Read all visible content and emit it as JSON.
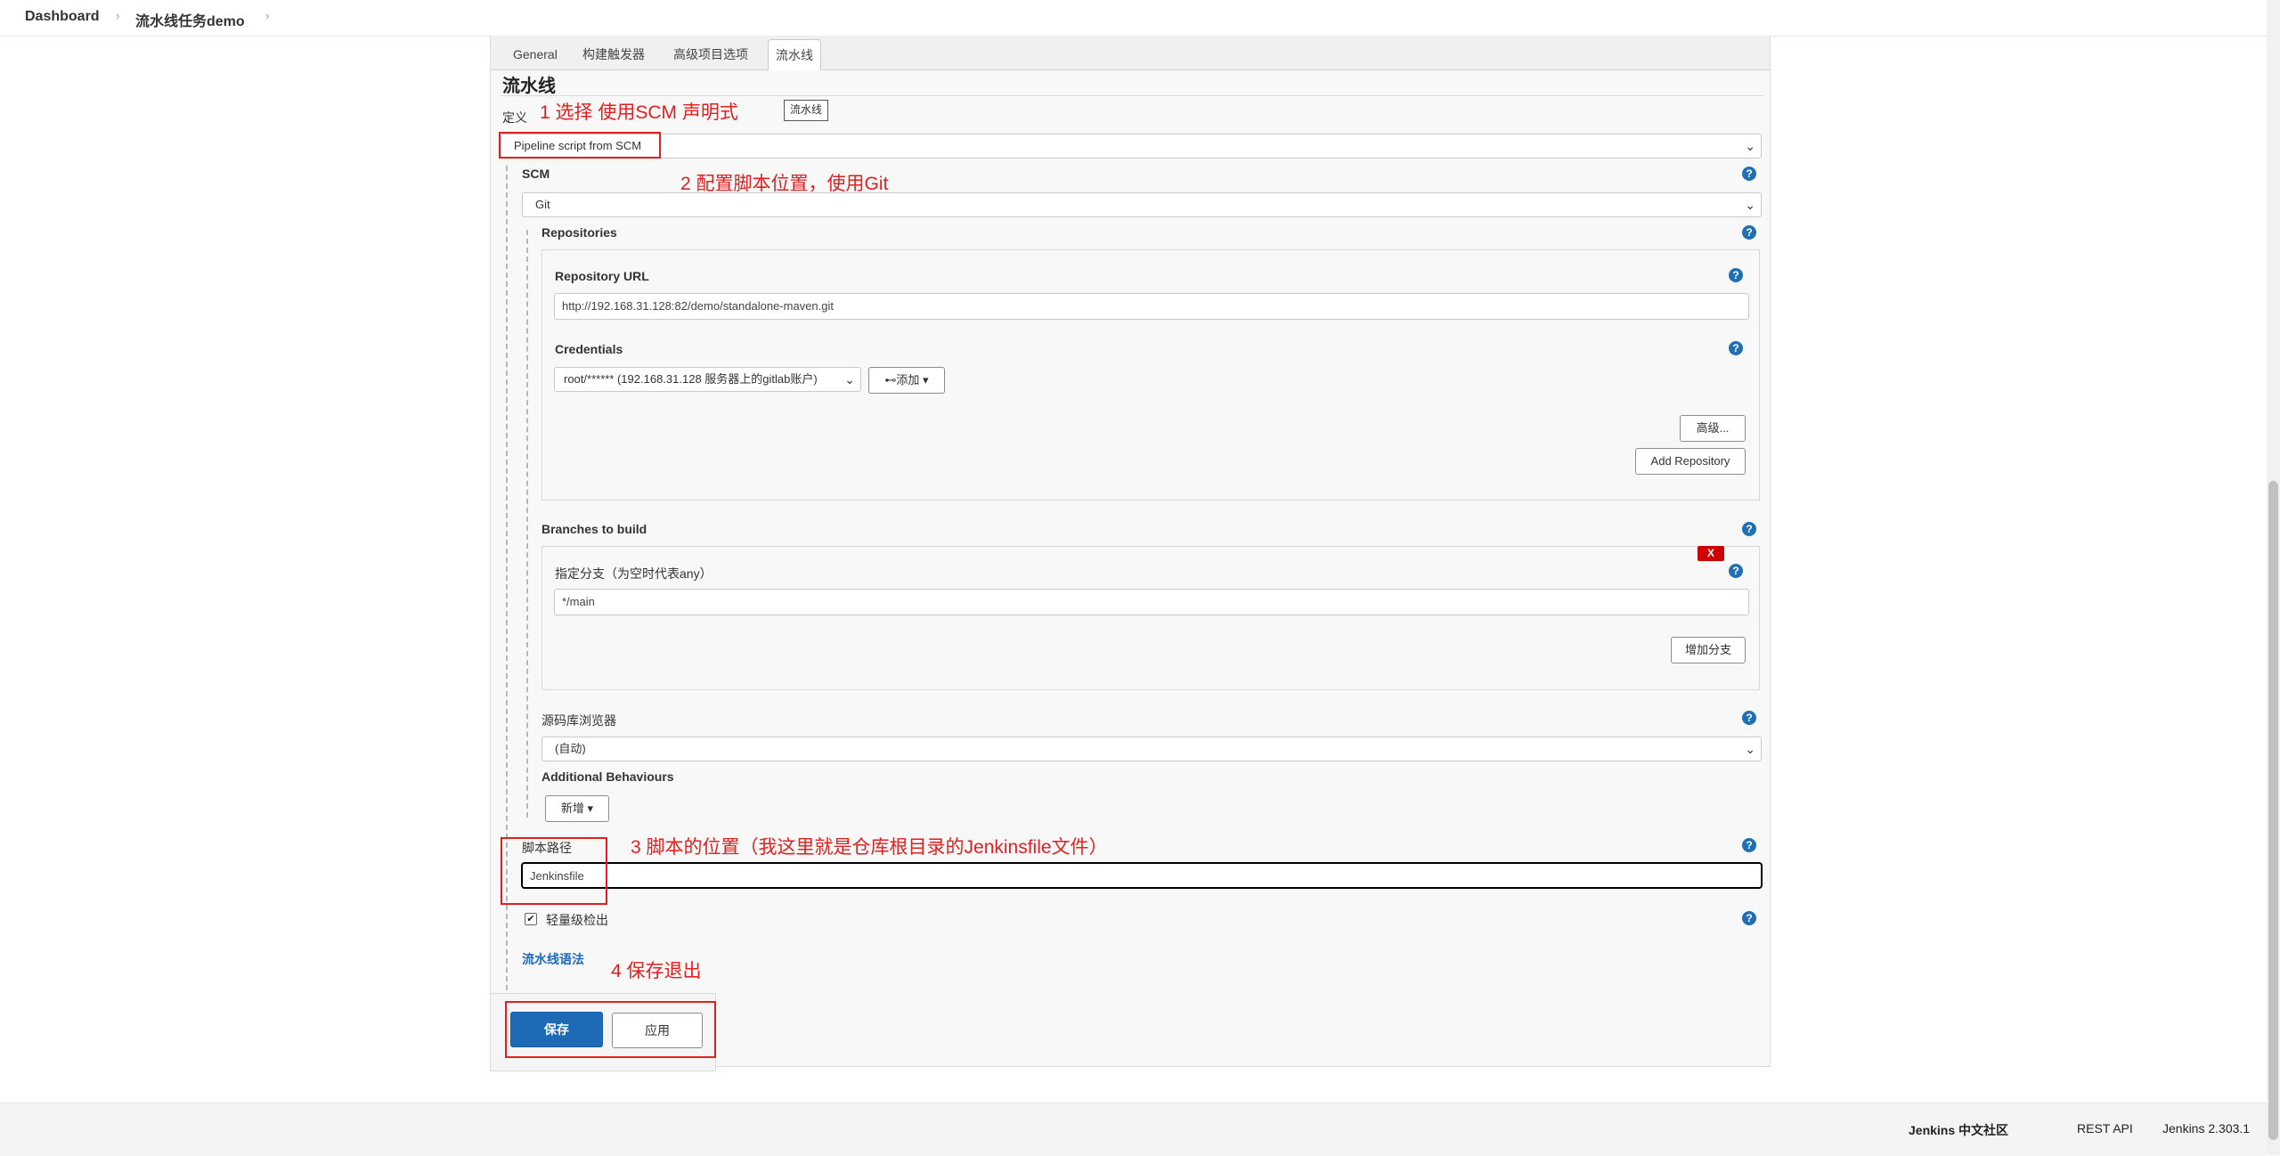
{
  "breadcrumb": {
    "dashboard": "Dashboard",
    "job": "流水线任务demo",
    "sep": "›"
  },
  "tabs": [
    "General",
    "构建触发器",
    "高级项目选项",
    "流水线"
  ],
  "section": {
    "title": "流水线",
    "definition_label": "定义",
    "tooltip": "流水线"
  },
  "definition": {
    "value": "Pipeline script from SCM"
  },
  "scm": {
    "label": "SCM",
    "value": "Git",
    "repositories_label": "Repositories",
    "repo_url_label": "Repository URL",
    "repo_url_value": "http://192.168.31.128:82/demo/standalone-maven.git",
    "credentials_label": "Credentials",
    "credentials_value": "root/****** (192.168.31.128 服务器上的gitlab账户)",
    "add_button": "添加",
    "advanced_button": "高级...",
    "add_repository_button": "Add Repository"
  },
  "branches": {
    "label": "Branches to build",
    "delete_label": "X",
    "specifier_label": "指定分支（为空时代表any）",
    "specifier_value": "*/main",
    "add_branch_button": "增加分支"
  },
  "browser": {
    "label": "源码库浏览器",
    "value": "(自动)"
  },
  "behaviours": {
    "label": "Additional Behaviours",
    "add_button": "新增"
  },
  "script_path": {
    "label": "脚本路径",
    "value": "Jenkinsfile"
  },
  "lightweight": {
    "label": "轻量级检出",
    "checked": true
  },
  "pipeline_syntax": "流水线语法",
  "buttons": {
    "save": "保存",
    "apply": "应用"
  },
  "annotations": {
    "a1": "1 选择 使用SCM 声明式",
    "a2": "2 配置脚本位置，使用Git",
    "a3": "3 脚本的位置（我这里就是仓库根目录的Jenkinsfile文件）",
    "a4": "4 保存退出"
  },
  "footer": {
    "community": "Jenkins 中文社区",
    "rest": "REST API",
    "version": "Jenkins 2.303.1"
  },
  "icons": {
    "help": "?",
    "check": "✔",
    "chevron": "⌄",
    "dropdown": "▾",
    "key": "⊷"
  }
}
